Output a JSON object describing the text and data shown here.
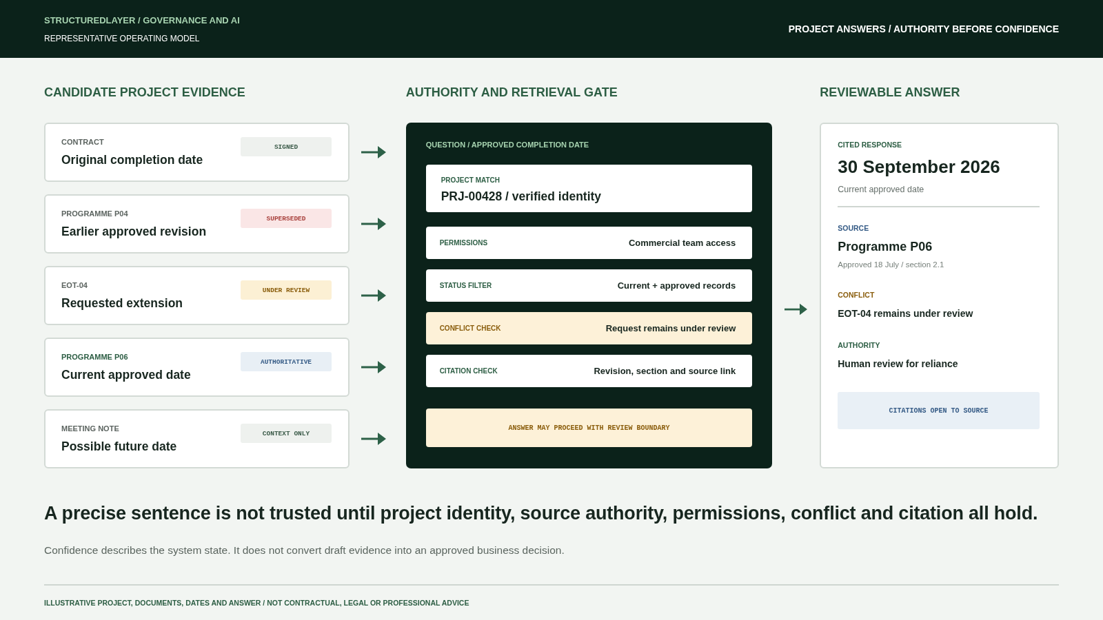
{
  "header": {
    "brand": "STRUCTUREDLAYER / GOVERNANCE AND AI",
    "subtitle": "REPRESENTATIVE OPERATING MODEL",
    "tagline": "PROJECT ANSWERS / AUTHORITY BEFORE CONFIDENCE"
  },
  "evidence": {
    "title": "CANDIDATE PROJECT EVIDENCE",
    "items": [
      {
        "source": "CONTRACT",
        "label": "Original completion date",
        "status": "SIGNED",
        "kind": "neutral"
      },
      {
        "source": "PROGRAMME P04",
        "label": "Earlier approved revision",
        "status": "SUPERSEDED",
        "kind": "superseded"
      },
      {
        "source": "EOT-04",
        "label": "Requested extension",
        "status": "UNDER REVIEW",
        "kind": "pending"
      },
      {
        "source": "PROGRAMME P06",
        "label": "Current approved date",
        "status": "AUTHORITATIVE",
        "kind": "authoritative"
      },
      {
        "source": "MEETING NOTE",
        "label": "Possible future date",
        "status": "CONTEXT ONLY",
        "kind": "neutral"
      }
    ]
  },
  "gate": {
    "title": "AUTHORITY AND RETRIEVAL GATE",
    "question": "QUESTION / APPROVED COMPLETION DATE",
    "match": {
      "label": "PROJECT MATCH",
      "value": "PRJ-00428 / verified identity"
    },
    "checks": [
      {
        "label": "PERMISSIONS",
        "value": "Commercial team access",
        "kind": "normal"
      },
      {
        "label": "STATUS FILTER",
        "value": "Current + approved records",
        "kind": "normal"
      },
      {
        "label": "CONFLICT CHECK",
        "value": "Request remains under review",
        "kind": "warning"
      },
      {
        "label": "CITATION CHECK",
        "value": "Revision, section and source link",
        "kind": "normal"
      }
    ],
    "outcome": "ANSWER MAY PROCEED WITH REVIEW BOUNDARY"
  },
  "answer": {
    "title": "REVIEWABLE ANSWER",
    "label": "CITED RESPONSE",
    "value": "30 September 2026",
    "note": "Current approved date",
    "sections": [
      {
        "label": "SOURCE",
        "value": "Programme P06",
        "note": "Approved 18 July / section 2.1",
        "kind": "source"
      },
      {
        "label": "CONFLICT",
        "value": "EOT-04 remains under review",
        "kind": "conflict"
      },
      {
        "label": "AUTHORITY",
        "value": "Human review for reliance",
        "kind": "authority"
      }
    ],
    "link": "CITATIONS OPEN TO SOURCE"
  },
  "headline": "A precise sentence is not trusted until project identity, source authority, permissions, conflict and citation all hold.",
  "summary": "Confidence describes the system state. It does not convert draft evidence into an approved business decision.",
  "footer": "ILLUSTRATIVE PROJECT, DOCUMENTS, DATES AND ANSWER / NOT CONTRACTUAL, LEGAL OR PROFESSIONAL ADVICE"
}
